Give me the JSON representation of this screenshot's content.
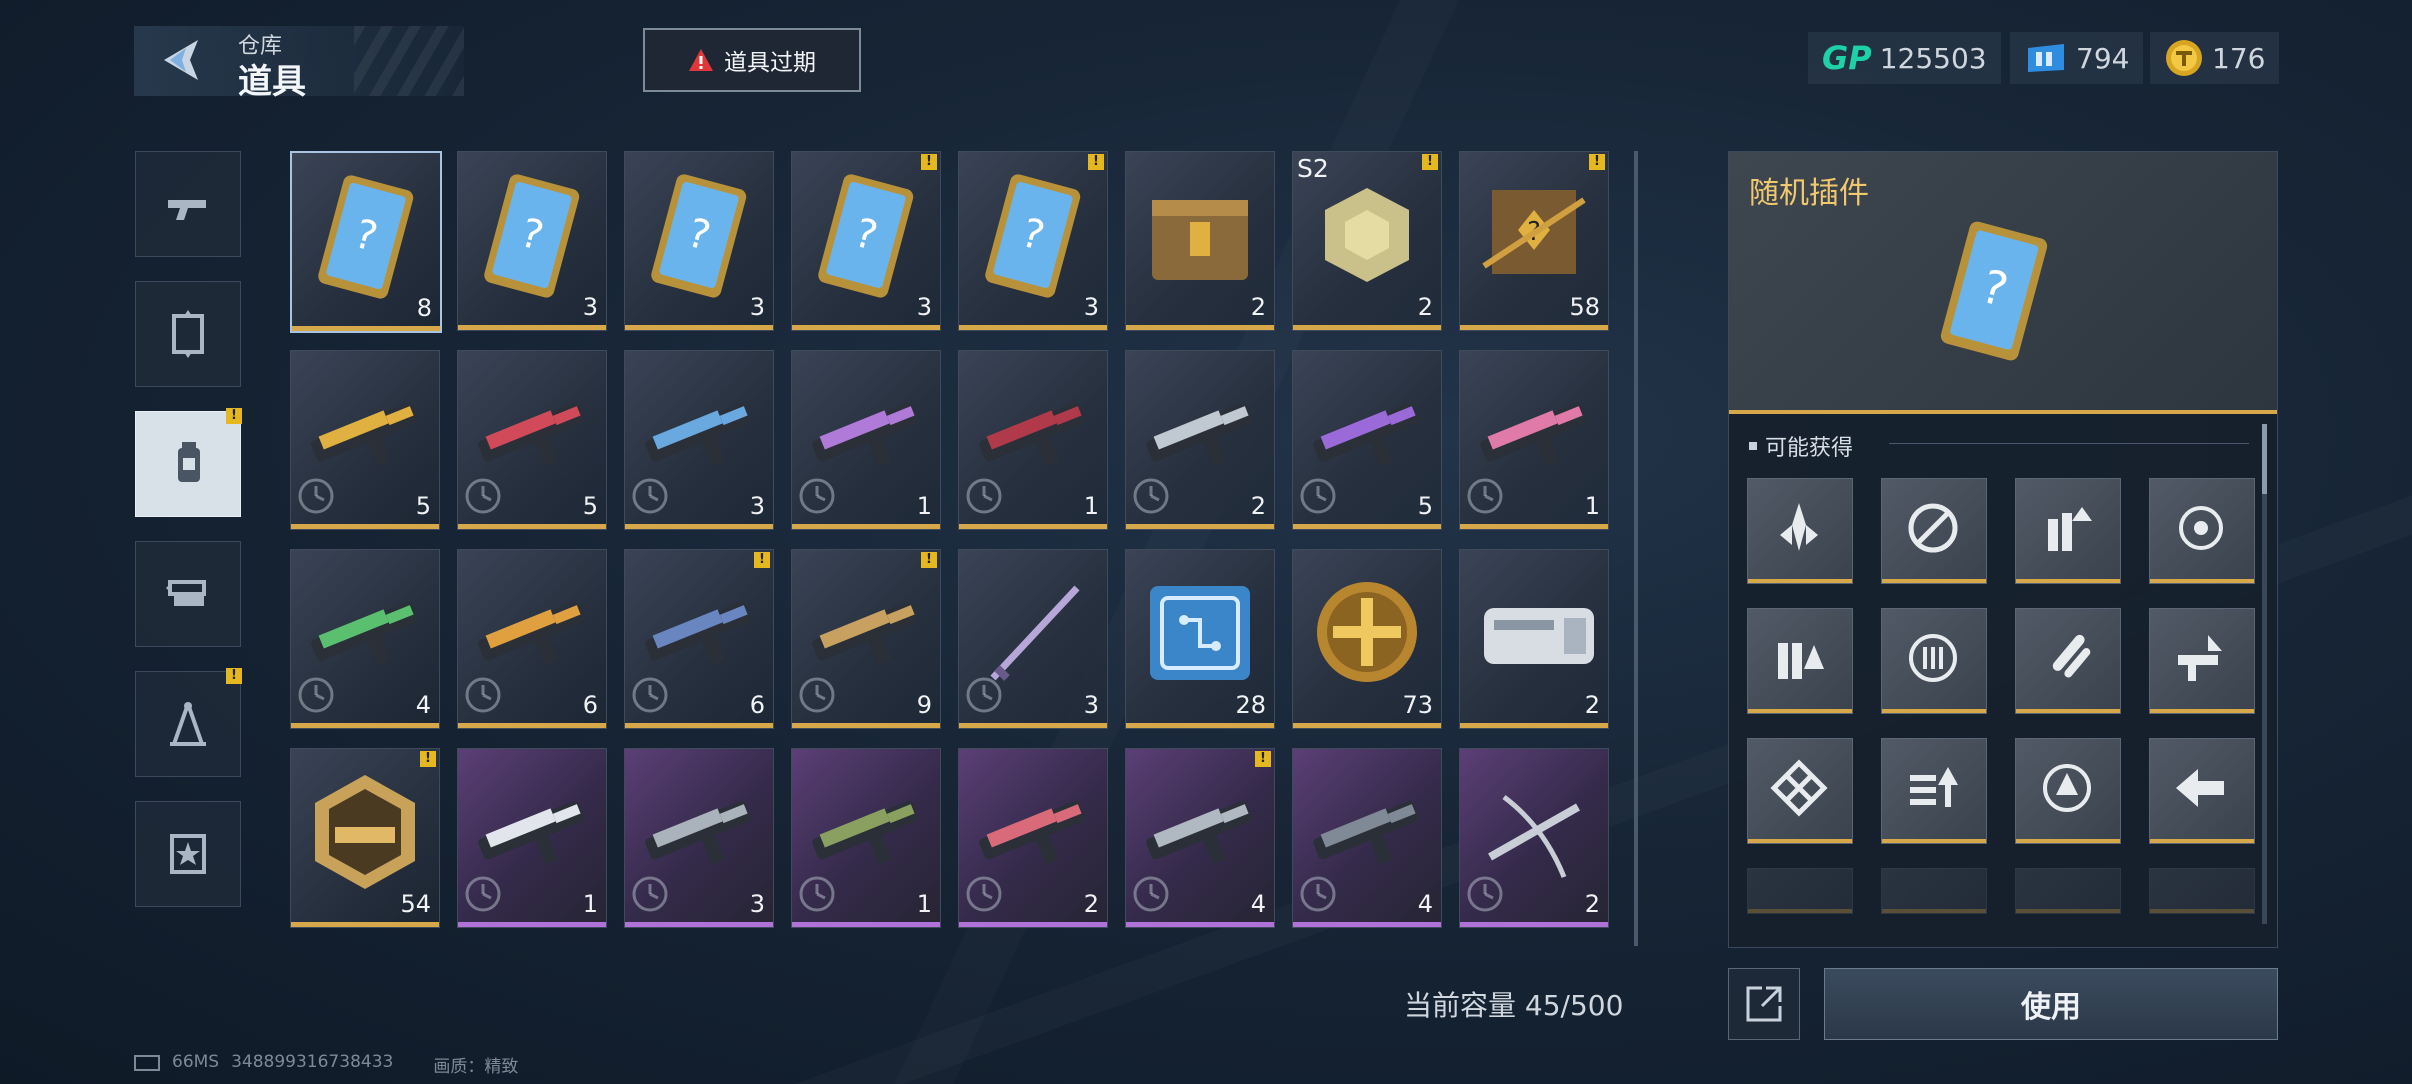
{
  "header": {
    "back_small": "仓库",
    "back_big": "道具",
    "expire_label": "道具过期"
  },
  "currencies": [
    {
      "icon": "gp-icon",
      "label": "GP",
      "value": "125503"
    },
    {
      "icon": "ticket-icon",
      "value": "794"
    },
    {
      "icon": "coin-icon",
      "value": "176"
    }
  ],
  "categories": [
    {
      "icon": "gun-icon",
      "badge": false,
      "active": false
    },
    {
      "icon": "frame-icon",
      "badge": false,
      "active": false
    },
    {
      "icon": "item-bag-icon",
      "badge": true,
      "active": true
    },
    {
      "icon": "swap-icon",
      "badge": false,
      "active": false
    },
    {
      "icon": "compass-icon",
      "badge": true,
      "active": false
    },
    {
      "icon": "star-badge-icon",
      "badge": false,
      "active": false
    }
  ],
  "items": [
    {
      "icon": "random-plugin-card",
      "count": "8",
      "badge": false,
      "rarity": "gold",
      "selected": true
    },
    {
      "icon": "random-plugin-card",
      "count": "3",
      "badge": false,
      "rarity": "gold"
    },
    {
      "icon": "random-plugin-card",
      "count": "3",
      "badge": false,
      "rarity": "gold"
    },
    {
      "icon": "random-plugin-card",
      "count": "3",
      "badge": true,
      "rarity": "gold"
    },
    {
      "icon": "random-plugin-card",
      "count": "3",
      "badge": true,
      "rarity": "gold"
    },
    {
      "icon": "supply-crate",
      "count": "2",
      "badge": false,
      "rarity": "gold"
    },
    {
      "icon": "s2-core-crate",
      "count": "2",
      "badge": true,
      "rarity": "gold",
      "season": "S2"
    },
    {
      "icon": "blueprint-sniper",
      "count": "58",
      "badge": true,
      "rarity": "gold"
    },
    {
      "icon": "rifle-yellow",
      "count": "5",
      "badge": false,
      "rarity": "gold",
      "timed": true
    },
    {
      "icon": "rifle-red",
      "count": "5",
      "badge": false,
      "rarity": "gold",
      "timed": true
    },
    {
      "icon": "rifle-blue",
      "count": "3",
      "badge": false,
      "rarity": "gold",
      "timed": true
    },
    {
      "icon": "rifle-purple",
      "count": "1",
      "badge": false,
      "rarity": "gold",
      "timed": true
    },
    {
      "icon": "rifle-black-red",
      "count": "1",
      "badge": false,
      "rarity": "gold",
      "timed": true
    },
    {
      "icon": "rifle-silver",
      "count": "2",
      "badge": false,
      "rarity": "gold",
      "timed": true
    },
    {
      "icon": "rifle-violet",
      "count": "5",
      "badge": false,
      "rarity": "gold",
      "timed": true
    },
    {
      "icon": "rifle-pink",
      "count": "1",
      "badge": false,
      "rarity": "gold",
      "timed": true
    },
    {
      "icon": "rifle-green",
      "count": "4",
      "badge": false,
      "rarity": "gold",
      "timed": true
    },
    {
      "icon": "smg-orange",
      "count": "6",
      "badge": false,
      "rarity": "gold",
      "timed": true
    },
    {
      "icon": "rifle-dark",
      "count": "6",
      "badge": true,
      "rarity": "gold",
      "timed": true
    },
    {
      "icon": "pistol-orange",
      "count": "9",
      "badge": true,
      "rarity": "gold",
      "timed": true
    },
    {
      "icon": "blade",
      "count": "3",
      "badge": false,
      "rarity": "gold",
      "timed": true
    },
    {
      "icon": "circuit-chip",
      "count": "28",
      "badge": false,
      "rarity": "gold"
    },
    {
      "icon": "gold-medal",
      "count": "73",
      "badge": false,
      "rarity": "gold"
    },
    {
      "icon": "module-silver",
      "count": "2",
      "badge": false,
      "rarity": "gold"
    },
    {
      "icon": "hex-emblem",
      "count": "54",
      "badge": true,
      "rarity": "gold"
    },
    {
      "icon": "smg-white",
      "count": "1",
      "badge": false,
      "rarity": "purple",
      "timed": true
    },
    {
      "icon": "rifle-gray",
      "count": "3",
      "badge": false,
      "rarity": "purple",
      "timed": true
    },
    {
      "icon": "rifle-camo",
      "count": "1",
      "badge": false,
      "rarity": "purple",
      "timed": true
    },
    {
      "icon": "rifle-red-white",
      "count": "2",
      "badge": false,
      "rarity": "purple",
      "timed": true
    },
    {
      "icon": "smg-gray",
      "count": "4",
      "badge": true,
      "rarity": "purple",
      "timed": true
    },
    {
      "icon": "pistol-black",
      "count": "4",
      "badge": false,
      "rarity": "purple",
      "timed": true
    },
    {
      "icon": "crossbow",
      "count": "2",
      "badge": false,
      "rarity": "purple",
      "timed": true
    }
  ],
  "capacity": "当前容量 45/500",
  "footer": {
    "ping": "66MS",
    "id": "348899316738433",
    "quality": "画质：精致"
  },
  "detail": {
    "name": "随机插件",
    "rewards_title": "可能获得",
    "rewards": [
      "rocket-plugin-icon",
      "stabilize-plugin-icon",
      "ammo-up-plugin-icon",
      "scope-plugin-icon",
      "ammo-alert-plugin-icon",
      "target-plugin-icon",
      "bullets-plugin-icon",
      "gun-upgrade-plugin-icon",
      "cross-plugin-icon",
      "speed-up-plugin-icon",
      "lock-target-plugin-icon",
      "dash-plugin-icon"
    ],
    "use_label": "使用"
  },
  "colors": {
    "gold": "#d6a84a",
    "purple": "#b071d8",
    "badge": "#e6b820",
    "detail_name": "#f0c86e"
  }
}
